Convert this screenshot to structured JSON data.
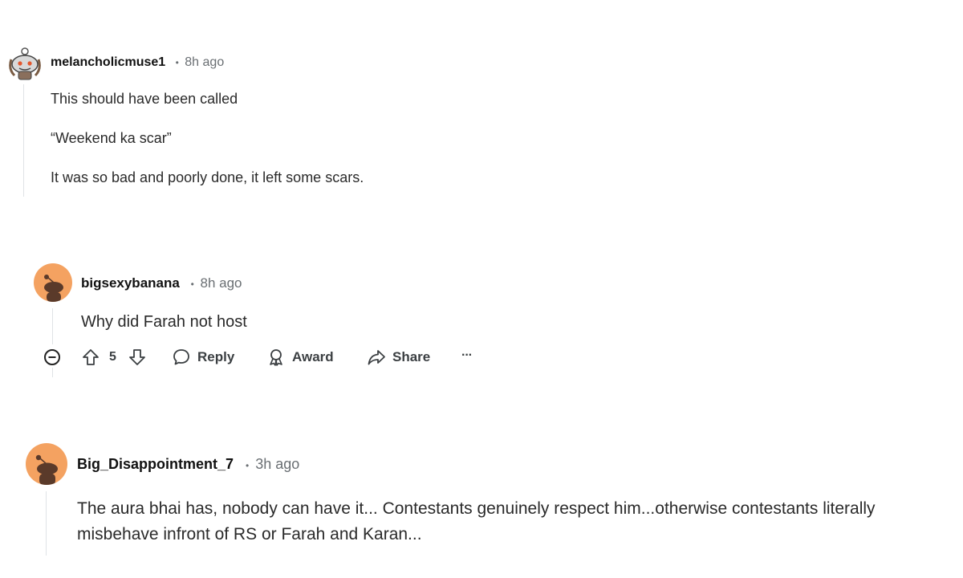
{
  "comments": [
    {
      "username": "melancholicmuse1",
      "separator": "•",
      "time": "8h ago",
      "paragraphs": [
        "This should have been called",
        "“Weekend ka scar”",
        "It was so bad and poorly done, it left some scars."
      ]
    },
    {
      "username": "bigsexybanana",
      "separator": "•",
      "time": "8h ago",
      "paragraphs": [
        "Why did Farah not host"
      ],
      "actions": {
        "vote_count": "5",
        "reply": "Reply",
        "award": "Award",
        "share": "Share",
        "more": "···"
      }
    },
    {
      "username": "Big_Disappointment_7",
      "separator": "•",
      "time": "3h ago",
      "paragraphs": [
        "The aura bhai has, nobody can have it... Contestants genuinely respect him...otherwise contestants literally misbehave infront of RS or Farah and Karan..."
      ]
    }
  ],
  "colors": {
    "avatar_orange": "#f4a261",
    "snoo_dark": "#5a3a2a",
    "thread_line": "#e0e3e6",
    "meta_gray": "#6a6f73"
  }
}
